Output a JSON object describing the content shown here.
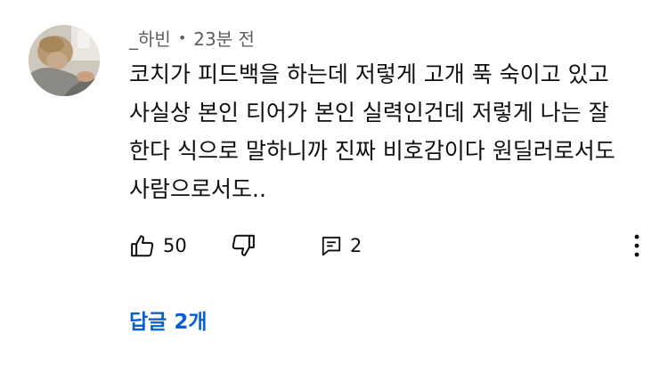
{
  "comment": {
    "author": "_하빈",
    "separator": "•",
    "time": "23분 전",
    "lines": [
      "코치가 피드백을 하는데 저렇게 고개 푹 숙이고 있고",
      "사실상 본인 티어가 본인 실력인건데 저렇게 나는 잘",
      "한다 식으로 말하니까 진짜 비호감이다 원딜러로서도",
      "사람으로서도.."
    ]
  },
  "actions": {
    "like_icon": "thumbs-up-icon",
    "like_count": "50",
    "dislike_icon": "thumbs-down-icon",
    "reply_icon": "reply-icon",
    "reply_count": "2",
    "more_icon": "more-vertical-icon"
  },
  "replies": {
    "label": "답글 2개",
    "color": "#065fd4"
  }
}
